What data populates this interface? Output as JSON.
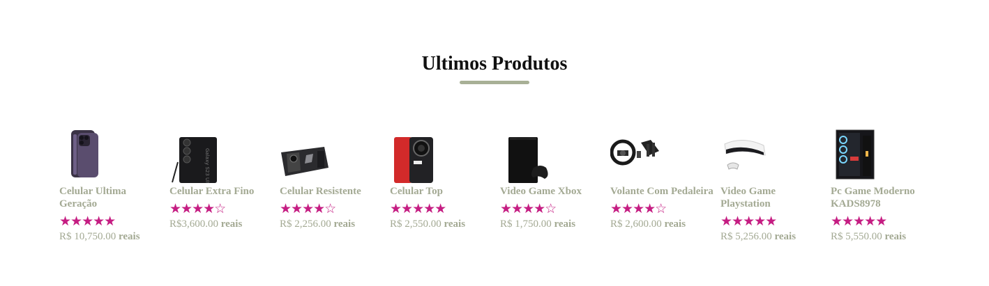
{
  "section": {
    "title": "Ultimos Produtos",
    "accent_color": "#a8b096",
    "rating_color": "#c51d82",
    "text_color": "#a3a993"
  },
  "products": [
    {
      "name": "Celular Ultima Geração",
      "stars": "★★★★★",
      "price": "R$ 10,750.00",
      "unit": "reais",
      "image": "iphone-purple"
    },
    {
      "name": "Celular Extra Fino",
      "stars": "★★★★☆",
      "price": "R$3,600.00",
      "unit": "reais",
      "image": "samsung-ultra"
    },
    {
      "name": "Celular Resistente",
      "stars": "★★★★☆",
      "price": "R$ 2,256.00",
      "unit": "reais",
      "image": "rog-gaming-phone"
    },
    {
      "name": "Celular Top",
      "stars": "★★★★★",
      "price": "R$ 2,550.00",
      "unit": "reais",
      "image": "xiaomi-ultra"
    },
    {
      "name": "Video Game Xbox",
      "stars": "★★★★☆",
      "price": "R$ 1,750.00",
      "unit": "reais",
      "image": "xbox-series-x"
    },
    {
      "name": "Volante Com Pedaleira",
      "stars": "★★★★☆",
      "price": "R$ 2,600.00",
      "unit": "reais",
      "image": "racing-wheel"
    },
    {
      "name": "Video Game Playstation",
      "stars": "★★★★★",
      "price": "R$ 5,256.00",
      "unit": "reais",
      "image": "playstation-5"
    },
    {
      "name": "Pc Game Moderno KADS8978",
      "stars": "★★★★★",
      "price": "R$ 5,550.00",
      "unit": "reais",
      "image": "gaming-pc"
    }
  ]
}
